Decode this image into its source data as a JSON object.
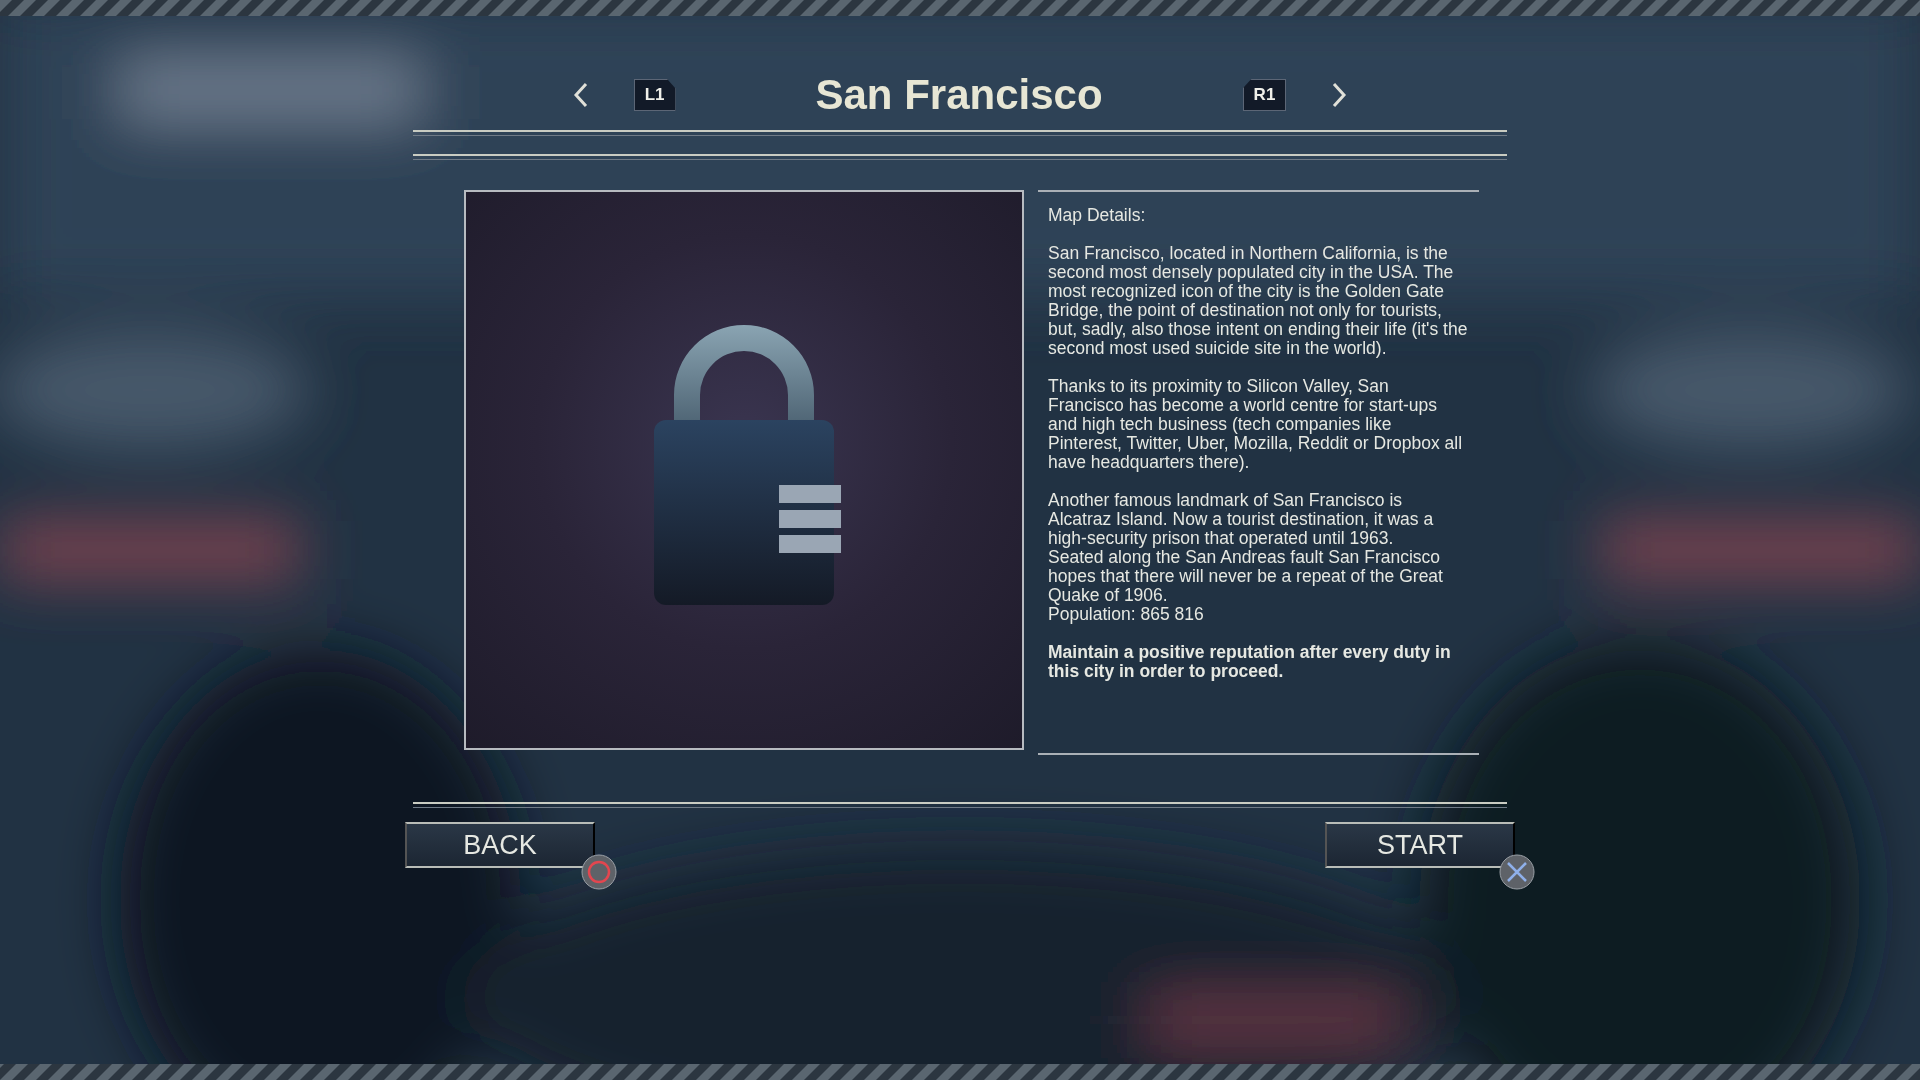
{
  "header": {
    "prev_key": "L1",
    "title": "San Francisco",
    "next_key": "R1"
  },
  "details": {
    "heading": "Map Details:",
    "sections": [
      [
        "San Francisco, located in Northern California, is the second most densely populated city in the USA. The most recognized icon of the city is the Golden Gate Bridge, the point of destination not only for tourists, but, sadly, also those intent on ending their life (it's the second most used suicide site in the world)."
      ],
      [
        "Thanks to its proximity to Silicon Valley, San Francisco has become a world centre for start-ups and high tech business (tech companies like Pinterest, Twitter, Uber, Mozilla, Reddit or Dropbox all have headquarters there)."
      ],
      [
        "Another famous landmark of San Francisco is Alcatraz Island. Now a tourist destination, it was a high-security prison that operated until 1963.",
        "Seated along the San Andreas fault San Francisco hopes that there will never be a repeat of the Great Quake of 1906.",
        "Population: 865 816"
      ]
    ],
    "requirement": "Maintain a positive reputation after every duty in this city in order to proceed."
  },
  "buttons": [
    {
      "label": "BACK",
      "kind": "circle"
    },
    {
      "label": "START",
      "kind": "cross"
    }
  ]
}
